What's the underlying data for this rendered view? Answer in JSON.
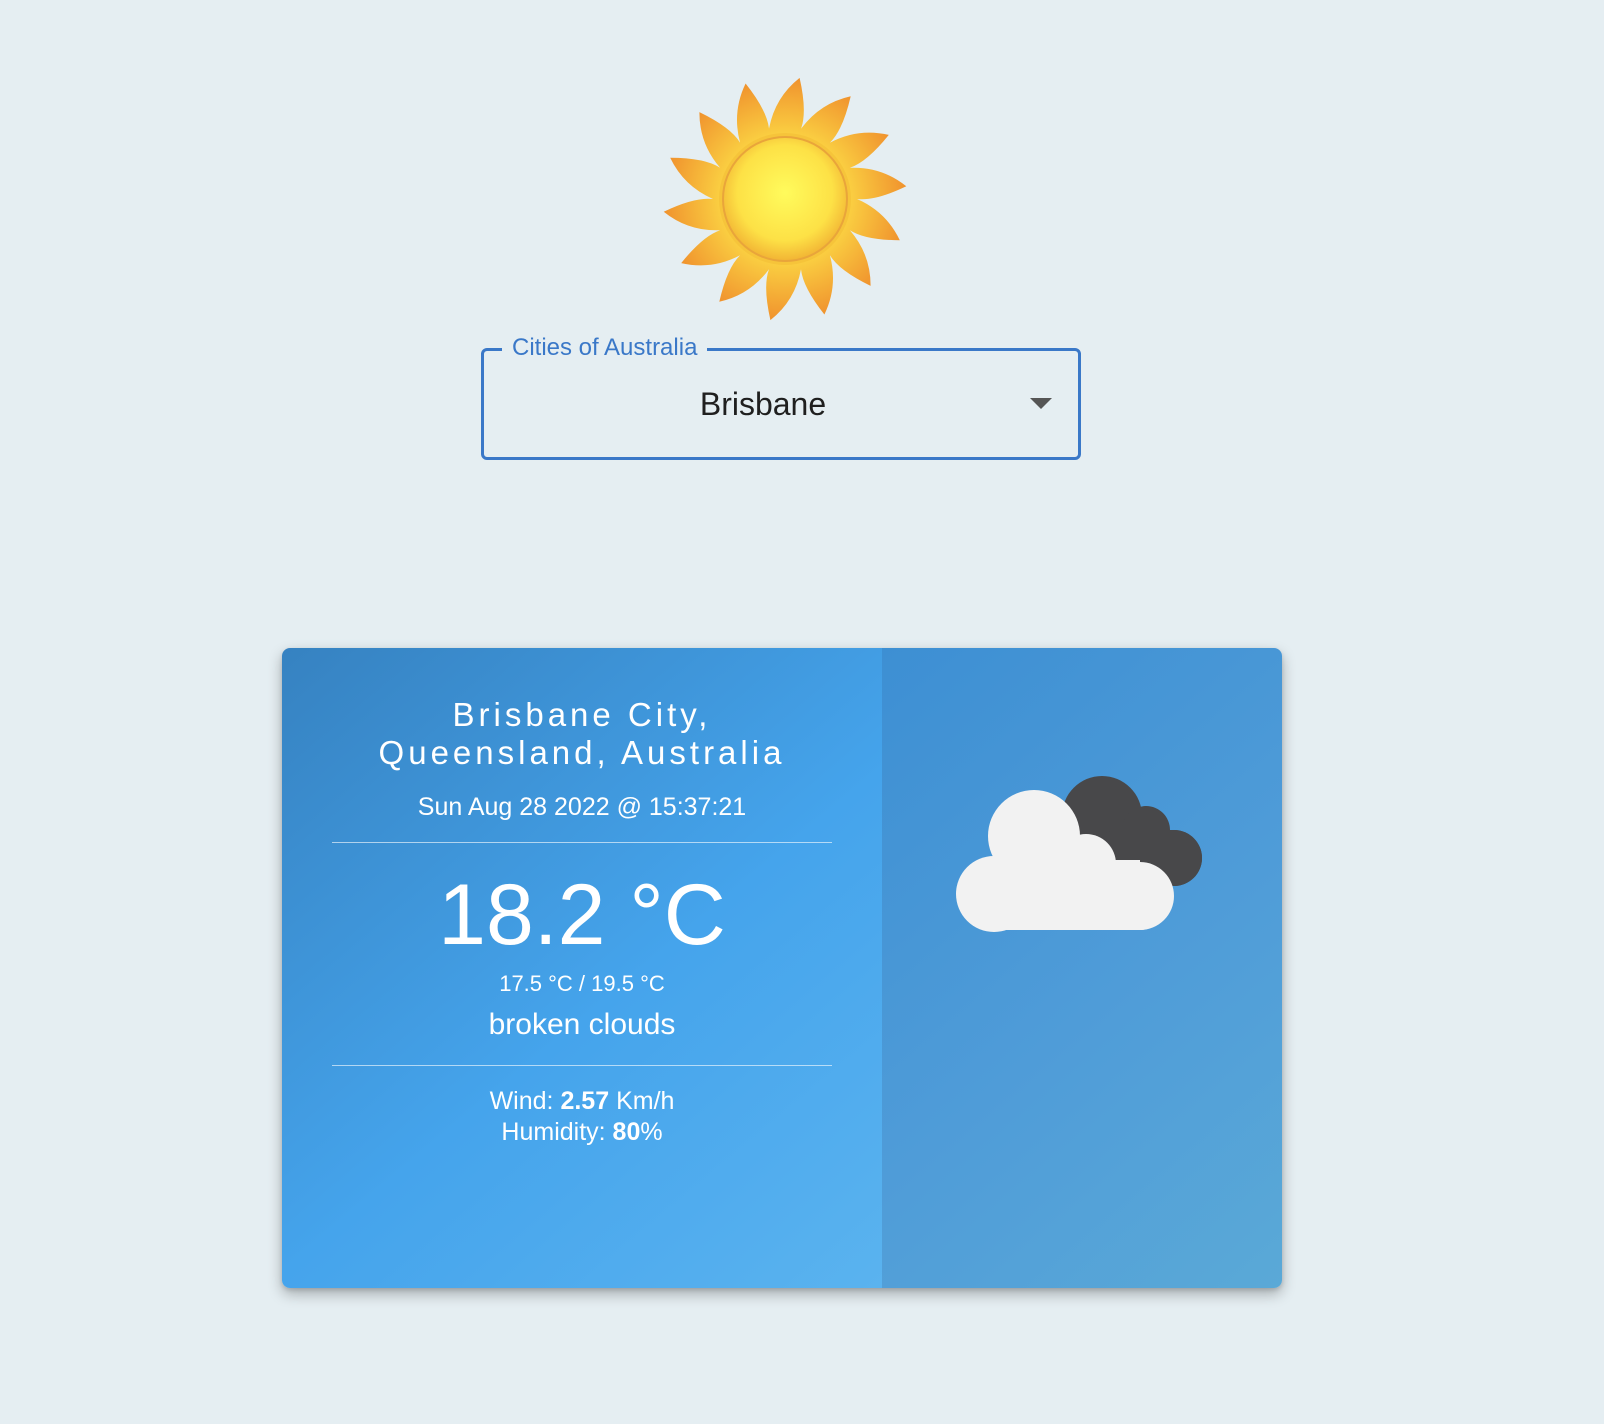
{
  "select": {
    "label": "Cities of Australia",
    "value": "Brisbane"
  },
  "weather": {
    "location": "Brisbane City, Queensland, Australia",
    "datetime": "Sun Aug 28 2022 @ 15:37:21",
    "temperature": "18.2 °C",
    "temp_range": "17.5 °C / 19.5 °C",
    "description": "broken clouds",
    "wind_label": "Wind:",
    "wind_value": "2.57",
    "wind_unit": "Km/h",
    "humidity_label": "Humidity:",
    "humidity_value": "80",
    "humidity_unit": "%"
  },
  "icons": {
    "logo": "sun-icon",
    "condition": "broken-clouds-icon"
  },
  "colors": {
    "background": "#e5eef2",
    "select_accent": "#3a78c8",
    "card_left": "#45a4ec",
    "card_right": "#4f9cd8",
    "sun": "#f7d23a",
    "cloud_light": "#f2f2f2",
    "cloud_dark": "#48484a"
  }
}
